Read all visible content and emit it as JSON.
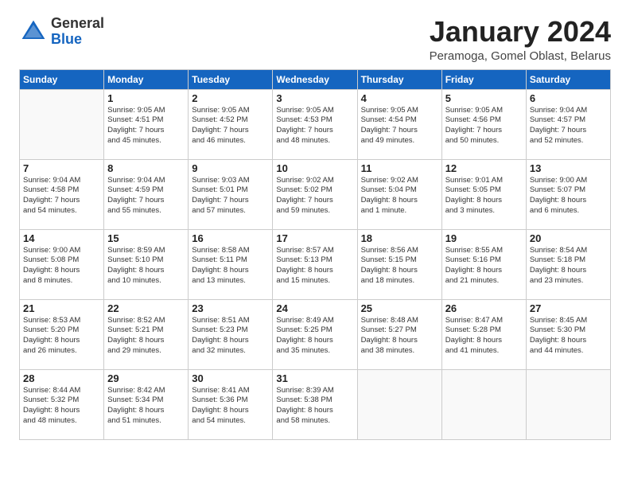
{
  "header": {
    "logo_general": "General",
    "logo_blue": "Blue",
    "month_title": "January 2024",
    "location": "Peramoga, Gomel Oblast, Belarus"
  },
  "weekdays": [
    "Sunday",
    "Monday",
    "Tuesday",
    "Wednesday",
    "Thursday",
    "Friday",
    "Saturday"
  ],
  "weeks": [
    [
      {
        "day": "",
        "info": ""
      },
      {
        "day": "1",
        "info": "Sunrise: 9:05 AM\nSunset: 4:51 PM\nDaylight: 7 hours\nand 45 minutes."
      },
      {
        "day": "2",
        "info": "Sunrise: 9:05 AM\nSunset: 4:52 PM\nDaylight: 7 hours\nand 46 minutes."
      },
      {
        "day": "3",
        "info": "Sunrise: 9:05 AM\nSunset: 4:53 PM\nDaylight: 7 hours\nand 48 minutes."
      },
      {
        "day": "4",
        "info": "Sunrise: 9:05 AM\nSunset: 4:54 PM\nDaylight: 7 hours\nand 49 minutes."
      },
      {
        "day": "5",
        "info": "Sunrise: 9:05 AM\nSunset: 4:56 PM\nDaylight: 7 hours\nand 50 minutes."
      },
      {
        "day": "6",
        "info": "Sunrise: 9:04 AM\nSunset: 4:57 PM\nDaylight: 7 hours\nand 52 minutes."
      }
    ],
    [
      {
        "day": "7",
        "info": "Sunrise: 9:04 AM\nSunset: 4:58 PM\nDaylight: 7 hours\nand 54 minutes."
      },
      {
        "day": "8",
        "info": "Sunrise: 9:04 AM\nSunset: 4:59 PM\nDaylight: 7 hours\nand 55 minutes."
      },
      {
        "day": "9",
        "info": "Sunrise: 9:03 AM\nSunset: 5:01 PM\nDaylight: 7 hours\nand 57 minutes."
      },
      {
        "day": "10",
        "info": "Sunrise: 9:02 AM\nSunset: 5:02 PM\nDaylight: 7 hours\nand 59 minutes."
      },
      {
        "day": "11",
        "info": "Sunrise: 9:02 AM\nSunset: 5:04 PM\nDaylight: 8 hours\nand 1 minute."
      },
      {
        "day": "12",
        "info": "Sunrise: 9:01 AM\nSunset: 5:05 PM\nDaylight: 8 hours\nand 3 minutes."
      },
      {
        "day": "13",
        "info": "Sunrise: 9:00 AM\nSunset: 5:07 PM\nDaylight: 8 hours\nand 6 minutes."
      }
    ],
    [
      {
        "day": "14",
        "info": "Sunrise: 9:00 AM\nSunset: 5:08 PM\nDaylight: 8 hours\nand 8 minutes."
      },
      {
        "day": "15",
        "info": "Sunrise: 8:59 AM\nSunset: 5:10 PM\nDaylight: 8 hours\nand 10 minutes."
      },
      {
        "day": "16",
        "info": "Sunrise: 8:58 AM\nSunset: 5:11 PM\nDaylight: 8 hours\nand 13 minutes."
      },
      {
        "day": "17",
        "info": "Sunrise: 8:57 AM\nSunset: 5:13 PM\nDaylight: 8 hours\nand 15 minutes."
      },
      {
        "day": "18",
        "info": "Sunrise: 8:56 AM\nSunset: 5:15 PM\nDaylight: 8 hours\nand 18 minutes."
      },
      {
        "day": "19",
        "info": "Sunrise: 8:55 AM\nSunset: 5:16 PM\nDaylight: 8 hours\nand 21 minutes."
      },
      {
        "day": "20",
        "info": "Sunrise: 8:54 AM\nSunset: 5:18 PM\nDaylight: 8 hours\nand 23 minutes."
      }
    ],
    [
      {
        "day": "21",
        "info": "Sunrise: 8:53 AM\nSunset: 5:20 PM\nDaylight: 8 hours\nand 26 minutes."
      },
      {
        "day": "22",
        "info": "Sunrise: 8:52 AM\nSunset: 5:21 PM\nDaylight: 8 hours\nand 29 minutes."
      },
      {
        "day": "23",
        "info": "Sunrise: 8:51 AM\nSunset: 5:23 PM\nDaylight: 8 hours\nand 32 minutes."
      },
      {
        "day": "24",
        "info": "Sunrise: 8:49 AM\nSunset: 5:25 PM\nDaylight: 8 hours\nand 35 minutes."
      },
      {
        "day": "25",
        "info": "Sunrise: 8:48 AM\nSunset: 5:27 PM\nDaylight: 8 hours\nand 38 minutes."
      },
      {
        "day": "26",
        "info": "Sunrise: 8:47 AM\nSunset: 5:28 PM\nDaylight: 8 hours\nand 41 minutes."
      },
      {
        "day": "27",
        "info": "Sunrise: 8:45 AM\nSunset: 5:30 PM\nDaylight: 8 hours\nand 44 minutes."
      }
    ],
    [
      {
        "day": "28",
        "info": "Sunrise: 8:44 AM\nSunset: 5:32 PM\nDaylight: 8 hours\nand 48 minutes."
      },
      {
        "day": "29",
        "info": "Sunrise: 8:42 AM\nSunset: 5:34 PM\nDaylight: 8 hours\nand 51 minutes."
      },
      {
        "day": "30",
        "info": "Sunrise: 8:41 AM\nSunset: 5:36 PM\nDaylight: 8 hours\nand 54 minutes."
      },
      {
        "day": "31",
        "info": "Sunrise: 8:39 AM\nSunset: 5:38 PM\nDaylight: 8 hours\nand 58 minutes."
      },
      {
        "day": "",
        "info": ""
      },
      {
        "day": "",
        "info": ""
      },
      {
        "day": "",
        "info": ""
      }
    ]
  ]
}
